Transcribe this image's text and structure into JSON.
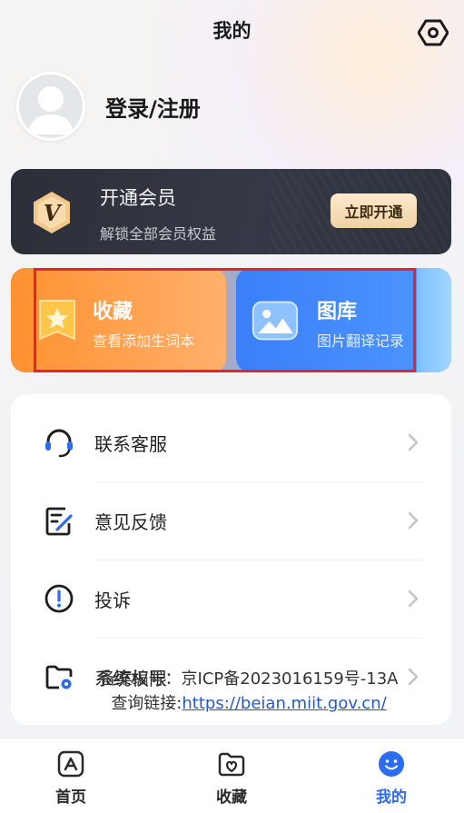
{
  "header": {
    "title": "我的",
    "settings_icon": "settings-hexagon-icon"
  },
  "profile": {
    "login_label": "登录/注册",
    "avatar_icon": "default-avatar-icon"
  },
  "vip": {
    "title": "开通会员",
    "subtitle": "解锁全部会员权益",
    "button_label": "立即开通",
    "badge_letter": "V",
    "badge_icon": "vip-badge-icon",
    "colors": {
      "card": "#2c2f38",
      "button": "#f5dcb4",
      "badge": "#f2c789"
    }
  },
  "features": {
    "favorites": {
      "title": "收藏",
      "subtitle": "查看添加生词本",
      "icon": "star-bookmark-icon"
    },
    "gallery": {
      "title": "图库",
      "subtitle": "图片翻译记录",
      "icon": "image-gallery-icon"
    },
    "highlight_color": "#e5252a"
  },
  "menu": {
    "items": [
      {
        "label": "联系客服",
        "icon": "headset-icon"
      },
      {
        "label": "意见反馈",
        "icon": "feedback-edit-icon"
      },
      {
        "label": "投诉",
        "icon": "exclamation-circle-icon"
      },
      {
        "label": "系统权限",
        "icon": "folder-settings-icon"
      }
    ]
  },
  "icp": {
    "line1": "备案编号：京ICP备2023016159号-13A",
    "link_prefix": "查询链接:",
    "link_text": "https://beian.miit.gov.cn/"
  },
  "tabbar": {
    "items": [
      {
        "label": "首页",
        "icon": "home-triangle-icon",
        "active": false
      },
      {
        "label": "收藏",
        "icon": "heart-folder-icon",
        "active": false
      },
      {
        "label": "我的",
        "icon": "smile-profile-icon",
        "active": true
      }
    ],
    "active_color": "#2b6cf0"
  }
}
